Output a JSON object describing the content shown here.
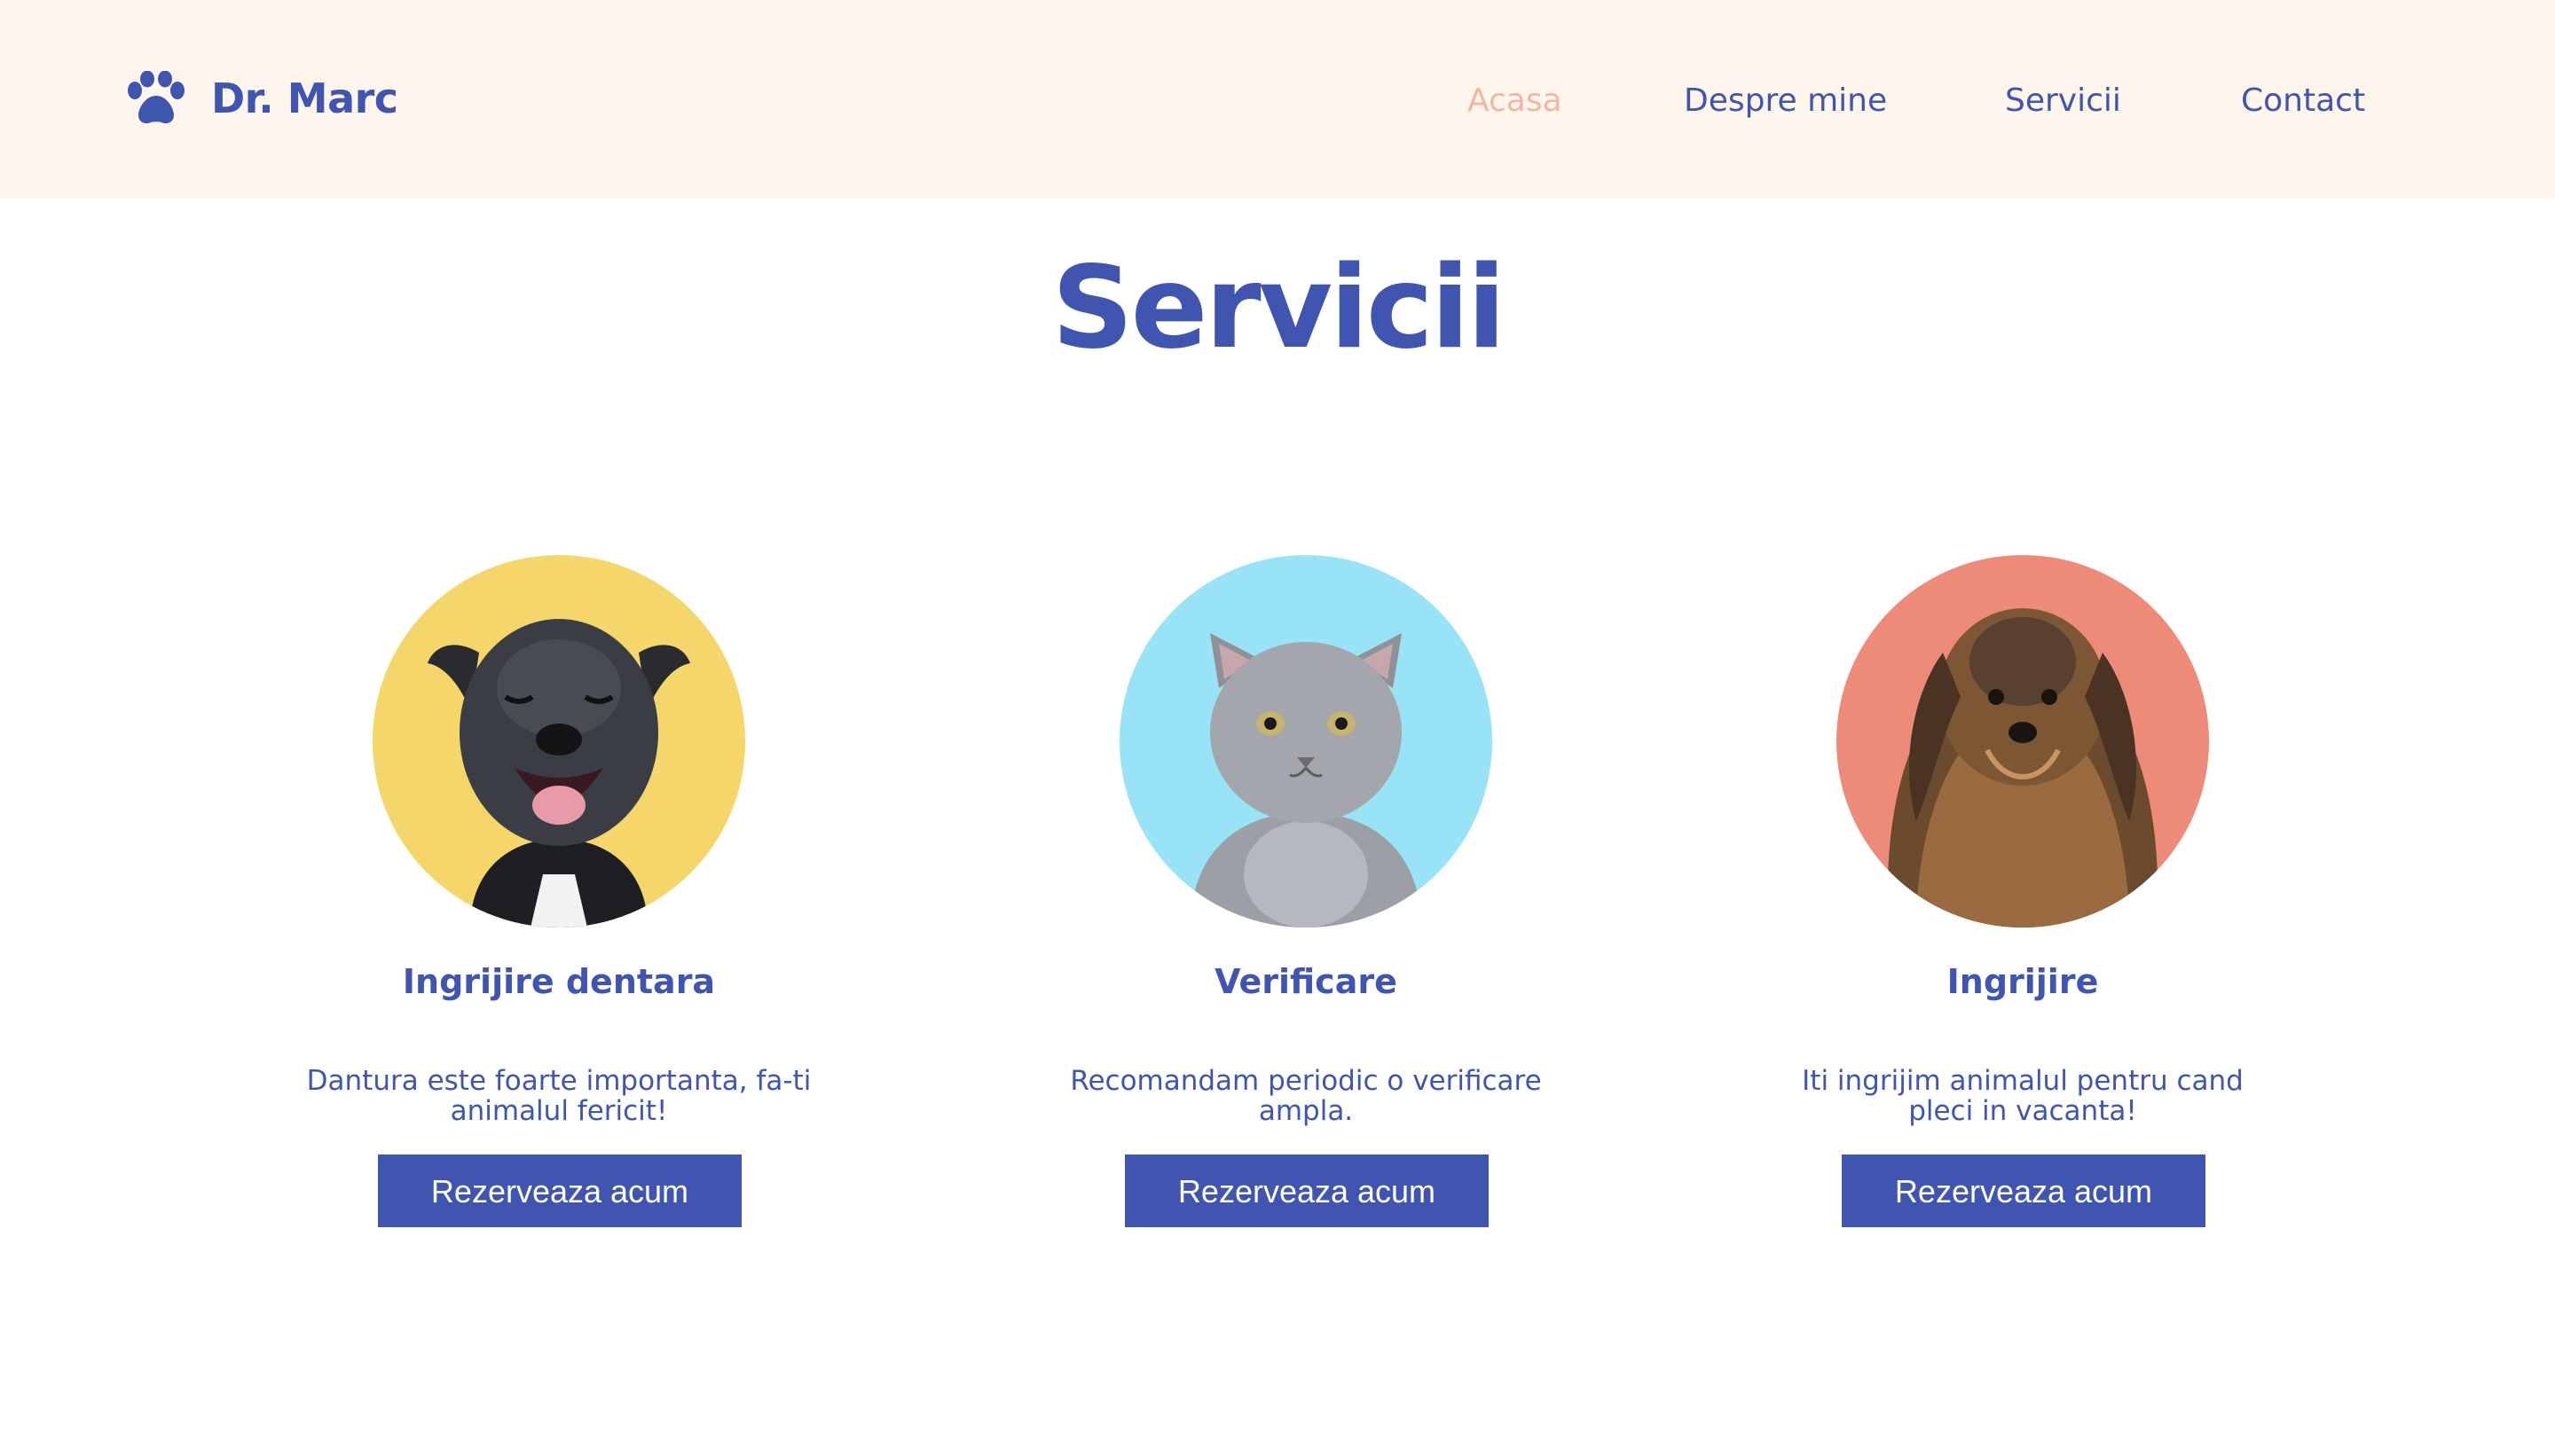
{
  "brand": {
    "name": "Dr. Marc",
    "icon": "paw-icon"
  },
  "nav": {
    "items": [
      {
        "label": "Acasa",
        "active": true
      },
      {
        "label": "Despre mine",
        "active": false
      },
      {
        "label": "Servicii",
        "active": false
      },
      {
        "label": "Contact",
        "active": false
      }
    ]
  },
  "page": {
    "title": "Servicii"
  },
  "services": [
    {
      "title": "Ingrijire dentara",
      "description": "Dantura este foarte importanta, fa-ti animalul fericit!",
      "button": "Rezerveaza acum",
      "image": "smiling-black-dog-photo",
      "bg_color": "#f5d66a"
    },
    {
      "title": "Verificare",
      "description": "Recomandam periodic o verificare ampla.",
      "button": "Rezerveaza acum",
      "image": "grey-kitten-photo",
      "bg_color": "#98e4f6"
    },
    {
      "title": "Ingrijire",
      "description": "Iti ingrijim animalul pentru cand pleci in vacanta!",
      "button": "Rezerveaza acum",
      "image": "yorkshire-terrier-photo",
      "bg_color": "#ee8b78"
    }
  ],
  "colors": {
    "primary": "#3f55b0",
    "header_bg": "#fef5ec",
    "nav_active": "#f2b6a4"
  }
}
